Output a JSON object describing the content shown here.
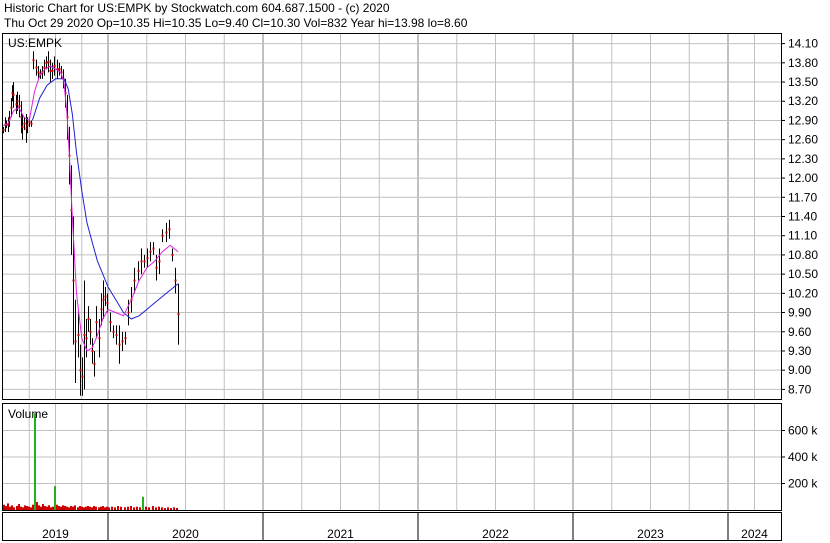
{
  "header": {
    "title": "Historic Chart for US:EMPK by Stockwatch.com 604.687.1500 - (c) 2020",
    "quote": "Thu Oct 29 2020  Op=10.35  Hi=10.35  Lo=9.40  Cl=10.30  Vol=832  Year hi=13.98  lo=8.60"
  },
  "chart_data": [
    {
      "type": "candlestick",
      "symbol_label": "US:EMPK",
      "yticks": [
        "14.10",
        "13.80",
        "13.50",
        "13.20",
        "12.90",
        "12.60",
        "12.30",
        "12.00",
        "11.70",
        "11.40",
        "11.10",
        "10.80",
        "10.50",
        "10.20",
        "9.90",
        "9.60",
        "9.30",
        "9.00",
        "8.70"
      ],
      "ylim": [
        8.55,
        14.25
      ],
      "x_years": [
        "2019",
        "2020",
        "2021",
        "2022",
        "2023",
        "2024"
      ],
      "grid": true,
      "colors": {
        "price_bar": "#000000",
        "up_mark": "#cc0000",
        "ma_short": "#e020e0",
        "ma_long": "#2020d0",
        "grid": "#c0c0c0"
      },
      "series": [
        {
          "kind": "price",
          "points": [
            {
              "t": 2019.0,
              "lo": 12.7,
              "hi": 12.8
            },
            {
              "t": 2019.02,
              "lo": 12.72,
              "hi": 12.95
            },
            {
              "t": 2019.03,
              "lo": 12.78,
              "hi": 12.9
            },
            {
              "t": 2019.05,
              "lo": 12.72,
              "hi": 12.95
            },
            {
              "t": 2019.06,
              "lo": 12.8,
              "hi": 13.05
            },
            {
              "t": 2019.08,
              "lo": 12.95,
              "hi": 13.25
            },
            {
              "t": 2019.09,
              "lo": 13.2,
              "hi": 13.45
            },
            {
              "t": 2019.1,
              "lo": 13.1,
              "hi": 13.5
            },
            {
              "t": 2019.12,
              "lo": 13.0,
              "hi": 13.3
            },
            {
              "t": 2019.13,
              "lo": 13.05,
              "hi": 13.35
            },
            {
              "t": 2019.15,
              "lo": 12.95,
              "hi": 13.3
            },
            {
              "t": 2019.17,
              "lo": 12.7,
              "hi": 13.2
            },
            {
              "t": 2019.18,
              "lo": 12.6,
              "hi": 13.0
            },
            {
              "t": 2019.2,
              "lo": 12.75,
              "hi": 12.95
            },
            {
              "t": 2019.22,
              "lo": 12.55,
              "hi": 13.0
            },
            {
              "t": 2019.23,
              "lo": 12.7,
              "hi": 12.95
            },
            {
              "t": 2019.25,
              "lo": 12.8,
              "hi": 12.95
            },
            {
              "t": 2019.27,
              "lo": 12.8,
              "hi": 12.9
            },
            {
              "t": 2019.29,
              "lo": 13.7,
              "hi": 13.98
            },
            {
              "t": 2019.31,
              "lo": 13.6,
              "hi": 13.85
            },
            {
              "t": 2019.33,
              "lo": 13.55,
              "hi": 13.75
            },
            {
              "t": 2019.35,
              "lo": 13.55,
              "hi": 13.7
            },
            {
              "t": 2019.37,
              "lo": 13.55,
              "hi": 13.75
            },
            {
              "t": 2019.39,
              "lo": 13.6,
              "hi": 13.85
            },
            {
              "t": 2019.41,
              "lo": 13.7,
              "hi": 13.9
            },
            {
              "t": 2019.43,
              "lo": 13.65,
              "hi": 13.98
            },
            {
              "t": 2019.45,
              "lo": 13.5,
              "hi": 13.85
            },
            {
              "t": 2019.47,
              "lo": 13.55,
              "hi": 13.8
            },
            {
              "t": 2019.49,
              "lo": 13.6,
              "hi": 13.9
            },
            {
              "t": 2019.51,
              "lo": 13.55,
              "hi": 13.85
            },
            {
              "t": 2019.53,
              "lo": 13.6,
              "hi": 13.8
            },
            {
              "t": 2019.55,
              "lo": 13.55,
              "hi": 13.75
            },
            {
              "t": 2019.57,
              "lo": 13.4,
              "hi": 13.7
            },
            {
              "t": 2019.59,
              "lo": 13.1,
              "hi": 13.55
            },
            {
              "t": 2019.61,
              "lo": 12.6,
              "hi": 13.3
            },
            {
              "t": 2019.63,
              "lo": 11.9,
              "hi": 12.8
            },
            {
              "t": 2019.65,
              "lo": 10.8,
              "hi": 12.2
            },
            {
              "t": 2019.67,
              "lo": 9.4,
              "hi": 11.4
            },
            {
              "t": 2019.69,
              "lo": 8.8,
              "hi": 10.1
            },
            {
              "t": 2019.71,
              "lo": 9.2,
              "hi": 9.9
            },
            {
              "t": 2019.73,
              "lo": 8.6,
              "hi": 9.4
            },
            {
              "t": 2019.75,
              "lo": 8.6,
              "hi": 9.2
            },
            {
              "t": 2019.77,
              "lo": 8.7,
              "hi": 10.4
            },
            {
              "t": 2019.79,
              "lo": 9.2,
              "hi": 9.8
            },
            {
              "t": 2019.81,
              "lo": 9.6,
              "hi": 10.0
            },
            {
              "t": 2019.83,
              "lo": 9.4,
              "hi": 9.8
            },
            {
              "t": 2019.85,
              "lo": 9.1,
              "hi": 9.5
            },
            {
              "t": 2019.87,
              "lo": 8.9,
              "hi": 9.3
            },
            {
              "t": 2019.89,
              "lo": 9.5,
              "hi": 10.0
            },
            {
              "t": 2019.91,
              "lo": 9.2,
              "hi": 9.8
            },
            {
              "t": 2019.93,
              "lo": 9.7,
              "hi": 10.2
            },
            {
              "t": 2019.95,
              "lo": 9.8,
              "hi": 10.4
            },
            {
              "t": 2019.97,
              "lo": 10.0,
              "hi": 10.3
            },
            {
              "t": 2019.99,
              "lo": 9.9,
              "hi": 10.2
            },
            {
              "t": 2020.01,
              "lo": 9.6,
              "hi": 9.9
            },
            {
              "t": 2020.03,
              "lo": 9.5,
              "hi": 9.7
            },
            {
              "t": 2020.05,
              "lo": 9.4,
              "hi": 9.7
            },
            {
              "t": 2020.07,
              "lo": 9.1,
              "hi": 9.7
            },
            {
              "t": 2020.09,
              "lo": 9.3,
              "hi": 9.6
            },
            {
              "t": 2020.11,
              "lo": 9.4,
              "hi": 9.6
            },
            {
              "t": 2020.13,
              "lo": 9.7,
              "hi": 10.1
            },
            {
              "t": 2020.15,
              "lo": 9.9,
              "hi": 10.3
            },
            {
              "t": 2020.17,
              "lo": 10.2,
              "hi": 10.6
            },
            {
              "t": 2020.19,
              "lo": 10.4,
              "hi": 10.7
            },
            {
              "t": 2020.21,
              "lo": 10.5,
              "hi": 10.9
            },
            {
              "t": 2020.23,
              "lo": 10.6,
              "hi": 10.8
            },
            {
              "t": 2020.25,
              "lo": 10.6,
              "hi": 10.9
            },
            {
              "t": 2020.27,
              "lo": 10.7,
              "hi": 11.0
            },
            {
              "t": 2020.29,
              "lo": 10.8,
              "hi": 11.0
            },
            {
              "t": 2020.31,
              "lo": 10.4,
              "hi": 10.8
            },
            {
              "t": 2020.33,
              "lo": 10.5,
              "hi": 10.9
            },
            {
              "t": 2020.35,
              "lo": 11.0,
              "hi": 11.2
            },
            {
              "t": 2020.37,
              "lo": 11.0,
              "hi": 11.3
            },
            {
              "t": 2020.39,
              "lo": 11.05,
              "hi": 11.35
            },
            {
              "t": 2020.41,
              "lo": 10.7,
              "hi": 10.9
            },
            {
              "t": 2020.43,
              "lo": 10.2,
              "hi": 10.6
            },
            {
              "t": 2020.45,
              "lo": 9.4,
              "hi": 10.35
            }
          ]
        },
        {
          "kind": "ma_short",
          "points": [
            [
              2019.0,
              12.82
            ],
            [
              2019.05,
              12.85
            ],
            [
              2019.1,
              13.05
            ],
            [
              2019.15,
              13.1
            ],
            [
              2019.2,
              12.95
            ],
            [
              2019.25,
              12.9
            ],
            [
              2019.3,
              13.35
            ],
            [
              2019.35,
              13.6
            ],
            [
              2019.4,
              13.7
            ],
            [
              2019.45,
              13.75
            ],
            [
              2019.5,
              13.7
            ],
            [
              2019.55,
              13.65
            ],
            [
              2019.58,
              13.5
            ],
            [
              2019.61,
              13.0
            ],
            [
              2019.63,
              12.4
            ],
            [
              2019.66,
              11.4
            ],
            [
              2019.7,
              10.2
            ],
            [
              2019.75,
              9.5
            ],
            [
              2019.8,
              9.3
            ],
            [
              2019.85,
              9.35
            ],
            [
              2019.9,
              9.55
            ],
            [
              2019.95,
              9.8
            ],
            [
              2020.0,
              9.95
            ],
            [
              2020.05,
              9.9
            ],
            [
              2020.1,
              9.85
            ],
            [
              2020.15,
              10.1
            ],
            [
              2020.2,
              10.4
            ],
            [
              2020.25,
              10.6
            ],
            [
              2020.3,
              10.7
            ],
            [
              2020.35,
              10.85
            ],
            [
              2020.4,
              10.95
            ],
            [
              2020.45,
              10.85
            ]
          ]
        },
        {
          "kind": "ma_long",
          "points": [
            [
              2019.28,
              12.9
            ],
            [
              2019.35,
              13.25
            ],
            [
              2019.42,
              13.45
            ],
            [
              2019.5,
              13.55
            ],
            [
              2019.58,
              13.55
            ],
            [
              2019.62,
              13.4
            ],
            [
              2019.66,
              13.0
            ],
            [
              2019.7,
              12.4
            ],
            [
              2019.75,
              11.8
            ],
            [
              2019.8,
              11.3
            ],
            [
              2019.85,
              11.0
            ],
            [
              2019.9,
              10.7
            ],
            [
              2019.95,
              10.5
            ],
            [
              2020.0,
              10.3
            ],
            [
              2020.05,
              10.1
            ],
            [
              2020.1,
              9.9
            ],
            [
              2020.15,
              9.8
            ],
            [
              2020.2,
              9.85
            ],
            [
              2020.25,
              9.95
            ],
            [
              2020.3,
              10.05
            ],
            [
              2020.35,
              10.15
            ],
            [
              2020.4,
              10.25
            ],
            [
              2020.45,
              10.35
            ]
          ]
        }
      ]
    },
    {
      "type": "bar",
      "title": "Volume",
      "yticks": [
        "600 k",
        "400 k",
        "200 k"
      ],
      "ylim": [
        0,
        800
      ],
      "unit": "k",
      "colors": {
        "normal": "#cc0000",
        "spike": "#20b020"
      },
      "series": [
        {
          "name": "",
          "points": [
            [
              2019.0,
              40
            ],
            [
              2019.02,
              30
            ],
            [
              2019.04,
              50
            ],
            [
              2019.06,
              25
            ],
            [
              2019.08,
              35
            ],
            [
              2019.1,
              20
            ],
            [
              2019.12,
              30
            ],
            [
              2019.14,
              45
            ],
            [
              2019.16,
              25
            ],
            [
              2019.18,
              20
            ],
            [
              2019.2,
              35
            ],
            [
              2019.22,
              30
            ],
            [
              2019.24,
              25
            ],
            [
              2019.26,
              20
            ],
            [
              2019.28,
              40
            ],
            [
              2019.295,
              730
            ],
            [
              2019.31,
              60
            ],
            [
              2019.33,
              35
            ],
            [
              2019.35,
              25
            ],
            [
              2019.37,
              45
            ],
            [
              2019.39,
              30
            ],
            [
              2019.41,
              25
            ],
            [
              2019.43,
              35
            ],
            [
              2019.45,
              20
            ],
            [
              2019.47,
              25
            ],
            [
              2019.485,
              180
            ],
            [
              2019.5,
              40
            ],
            [
              2019.52,
              30
            ],
            [
              2019.54,
              25
            ],
            [
              2019.56,
              35
            ],
            [
              2019.58,
              30
            ],
            [
              2019.6,
              25
            ],
            [
              2019.62,
              20
            ],
            [
              2019.64,
              30
            ],
            [
              2019.66,
              25
            ],
            [
              2019.68,
              35
            ],
            [
              2019.7,
              20
            ],
            [
              2019.72,
              30
            ],
            [
              2019.74,
              25
            ],
            [
              2019.76,
              20
            ],
            [
              2019.78,
              25
            ],
            [
              2019.8,
              30
            ],
            [
              2019.82,
              25
            ],
            [
              2019.84,
              20
            ],
            [
              2019.86,
              30
            ],
            [
              2019.88,
              25
            ],
            [
              2019.9,
              20
            ],
            [
              2019.92,
              25
            ],
            [
              2019.94,
              30
            ],
            [
              2019.96,
              20
            ],
            [
              2019.98,
              25
            ],
            [
              2020.0,
              20
            ],
            [
              2020.02,
              25
            ],
            [
              2020.04,
              20
            ],
            [
              2020.06,
              30
            ],
            [
              2020.08,
              25
            ],
            [
              2020.1,
              20
            ],
            [
              2020.12,
              25
            ],
            [
              2020.14,
              30
            ],
            [
              2020.16,
              20
            ],
            [
              2020.18,
              25
            ],
            [
              2020.2,
              20
            ],
            [
              2020.22,
              100
            ],
            [
              2020.24,
              25
            ],
            [
              2020.26,
              20
            ],
            [
              2020.28,
              30
            ],
            [
              2020.3,
              20
            ],
            [
              2020.32,
              25
            ],
            [
              2020.34,
              20
            ],
            [
              2020.36,
              15
            ],
            [
              2020.38,
              20
            ],
            [
              2020.4,
              15
            ],
            [
              2020.42,
              20
            ],
            [
              2020.44,
              15
            ]
          ]
        }
      ]
    }
  ]
}
